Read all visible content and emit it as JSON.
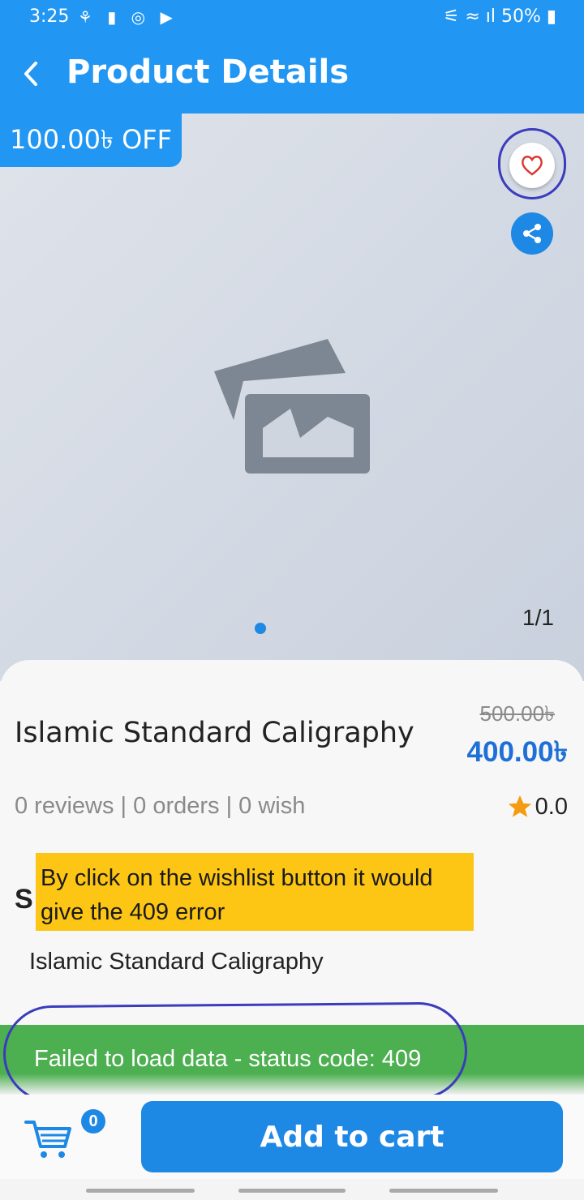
{
  "status_bar": {
    "time": "3:25",
    "battery": "50%"
  },
  "app_bar": {
    "title": "Product Details"
  },
  "gallery": {
    "discount_badge": "100.00৳ OFF",
    "counter": "1/1"
  },
  "product": {
    "name": "Islamic Standard Caligraphy",
    "old_price": "500.00৳",
    "price": "400.00৳",
    "stats": "0 reviews | 0 orders | 0 wish",
    "rating": "0.0",
    "section_heading_partial": "S",
    "description": "Islamic Standard Caligraphy"
  },
  "annotation": {
    "note": "By click on the wishlist button it would give the 409 error"
  },
  "snackbar": {
    "message": "Failed to load data - status code: 409"
  },
  "bottom": {
    "cart_count": "0",
    "add_to_cart": "Add to cart"
  },
  "colors": {
    "primary": "#2196f3",
    "snackbar": "#4caf50",
    "note_bg": "#fdc614",
    "annotation_ink": "#3b3bbd"
  }
}
